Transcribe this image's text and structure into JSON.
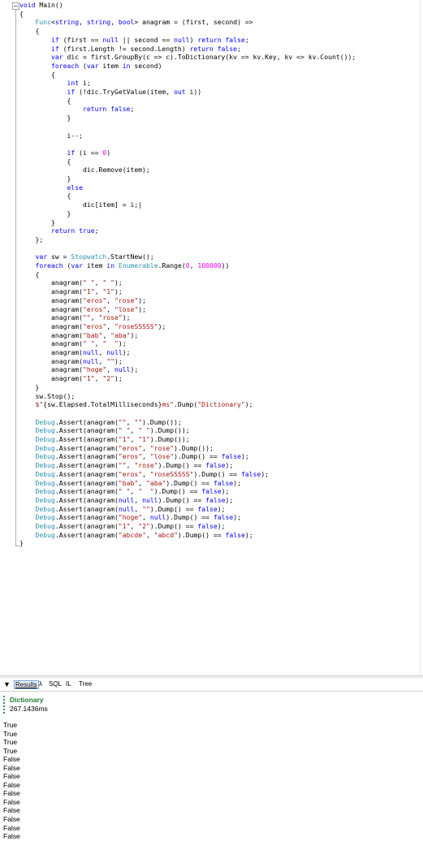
{
  "editor": {
    "fold_glyph": "−",
    "lines": [
      [
        [
          "k",
          "void "
        ],
        [
          "p",
          "Main()"
        ]
      ],
      [
        [
          "p",
          "{"
        ]
      ],
      [
        [
          "p",
          "    "
        ],
        [
          "ty",
          "Func"
        ],
        [
          "p",
          "<"
        ],
        [
          "k",
          "string"
        ],
        [
          "p",
          ", "
        ],
        [
          "k",
          "string"
        ],
        [
          "p",
          ", "
        ],
        [
          "k",
          "bool"
        ],
        [
          "p",
          "> anagram = (first, second) =>"
        ]
      ],
      [
        [
          "p",
          "    {"
        ]
      ],
      [
        [
          "p",
          "        "
        ],
        [
          "k",
          "if"
        ],
        [
          "p",
          " (first == "
        ],
        [
          "k",
          "null"
        ],
        [
          "p",
          " || second == "
        ],
        [
          "k",
          "null"
        ],
        [
          "p",
          ") "
        ],
        [
          "k",
          "return false"
        ],
        [
          "p",
          ";"
        ]
      ],
      [
        [
          "p",
          "        "
        ],
        [
          "k",
          "if"
        ],
        [
          "p",
          " (first.Length != second.Length) "
        ],
        [
          "k",
          "return false"
        ],
        [
          "p",
          ";"
        ]
      ],
      [
        [
          "p",
          "        "
        ],
        [
          "k",
          "var"
        ],
        [
          "p",
          " dic = first.GroupBy(c => c).ToDictionary(kv => kv.Key, kv => kv.Count());"
        ]
      ],
      [
        [
          "p",
          "        "
        ],
        [
          "k",
          "foreach"
        ],
        [
          "p",
          " ("
        ],
        [
          "k",
          "var"
        ],
        [
          "p",
          " item "
        ],
        [
          "k",
          "in"
        ],
        [
          "p",
          " second)"
        ]
      ],
      [
        [
          "p",
          "        {"
        ]
      ],
      [
        [
          "p",
          "            "
        ],
        [
          "k",
          "int"
        ],
        [
          "p",
          " i;"
        ]
      ],
      [
        [
          "p",
          "            "
        ],
        [
          "k",
          "if"
        ],
        [
          "p",
          " (!dic.TryGetValue(item, "
        ],
        [
          "k",
          "out"
        ],
        [
          "p",
          " i))"
        ]
      ],
      [
        [
          "p",
          "            {"
        ]
      ],
      [
        [
          "p",
          "                "
        ],
        [
          "k",
          "return false"
        ],
        [
          "p",
          ";"
        ]
      ],
      [
        [
          "p",
          "            }"
        ]
      ],
      [],
      [
        [
          "p",
          "            i--;"
        ]
      ],
      [],
      [
        [
          "p",
          "            "
        ],
        [
          "k",
          "if"
        ],
        [
          "p",
          " (i == "
        ],
        [
          "n",
          "0"
        ],
        [
          "p",
          ")"
        ]
      ],
      [
        [
          "p",
          "            {"
        ]
      ],
      [
        [
          "p",
          "                dic.Remove(item);"
        ]
      ],
      [
        [
          "p",
          "            }"
        ]
      ],
      [
        [
          "p",
          "            "
        ],
        [
          "k",
          "else"
        ]
      ],
      [
        [
          "p",
          "            {"
        ]
      ],
      [
        [
          "p",
          "                dic[item] = i;|"
        ]
      ],
      [
        [
          "p",
          "            }"
        ]
      ],
      [
        [
          "p",
          "        }"
        ]
      ],
      [
        [
          "p",
          "        "
        ],
        [
          "k",
          "return true"
        ],
        [
          "p",
          ";"
        ]
      ],
      [
        [
          "p",
          "    };"
        ]
      ],
      [],
      [
        [
          "p",
          "    "
        ],
        [
          "k",
          "var"
        ],
        [
          "p",
          " sw = "
        ],
        [
          "ty",
          "Stopwatch"
        ],
        [
          "p",
          ".StartNew();"
        ]
      ],
      [
        [
          "p",
          "    "
        ],
        [
          "k",
          "foreach"
        ],
        [
          "p",
          " ("
        ],
        [
          "k",
          "var"
        ],
        [
          "p",
          " item "
        ],
        [
          "k",
          "in"
        ],
        [
          "p",
          " "
        ],
        [
          "ty",
          "Enumerable"
        ],
        [
          "p",
          ".Range("
        ],
        [
          "n",
          "0"
        ],
        [
          "p",
          ", "
        ],
        [
          "n",
          "100000"
        ],
        [
          "p",
          "))"
        ]
      ],
      [
        [
          "p",
          "    {"
        ]
      ],
      [
        [
          "p",
          "        anagram("
        ],
        [
          "s",
          "\" \""
        ],
        [
          "p",
          ", "
        ],
        [
          "s",
          "\" \""
        ],
        [
          "p",
          ");"
        ]
      ],
      [
        [
          "p",
          "        anagram("
        ],
        [
          "s",
          "\"1\""
        ],
        [
          "p",
          ", "
        ],
        [
          "s",
          "\"1\""
        ],
        [
          "p",
          ");"
        ]
      ],
      [
        [
          "p",
          "        anagram("
        ],
        [
          "s",
          "\"eros\""
        ],
        [
          "p",
          ", "
        ],
        [
          "s",
          "\"rose\""
        ],
        [
          "p",
          ");"
        ]
      ],
      [
        [
          "p",
          "        anagram("
        ],
        [
          "s",
          "\"eros\""
        ],
        [
          "p",
          ", "
        ],
        [
          "s",
          "\"lose\""
        ],
        [
          "p",
          ");"
        ]
      ],
      [
        [
          "p",
          "        anagram("
        ],
        [
          "s",
          "\"\""
        ],
        [
          "p",
          ", "
        ],
        [
          "s",
          "\"rose\""
        ],
        [
          "p",
          ");"
        ]
      ],
      [
        [
          "p",
          "        anagram("
        ],
        [
          "s",
          "\"eros\""
        ],
        [
          "p",
          ", "
        ],
        [
          "s",
          "\"roseSSSSS\""
        ],
        [
          "p",
          ");"
        ]
      ],
      [
        [
          "p",
          "        anagram("
        ],
        [
          "s",
          "\"bab\""
        ],
        [
          "p",
          ", "
        ],
        [
          "s",
          "\"aba\""
        ],
        [
          "p",
          ");"
        ]
      ],
      [
        [
          "p",
          "        anagram("
        ],
        [
          "s",
          "\" \""
        ],
        [
          "p",
          ", "
        ],
        [
          "s",
          "\"  \""
        ],
        [
          "p",
          ");"
        ]
      ],
      [
        [
          "p",
          "        anagram("
        ],
        [
          "k",
          "null"
        ],
        [
          "p",
          ", "
        ],
        [
          "k",
          "null"
        ],
        [
          "p",
          ");"
        ]
      ],
      [
        [
          "p",
          "        anagram("
        ],
        [
          "k",
          "null"
        ],
        [
          "p",
          ", "
        ],
        [
          "s",
          "\"\""
        ],
        [
          "p",
          ");"
        ]
      ],
      [
        [
          "p",
          "        anagram("
        ],
        [
          "s",
          "\"hoge\""
        ],
        [
          "p",
          ", "
        ],
        [
          "k",
          "null"
        ],
        [
          "p",
          ");"
        ]
      ],
      [
        [
          "p",
          "        anagram("
        ],
        [
          "s",
          "\"1\""
        ],
        [
          "p",
          ", "
        ],
        [
          "s",
          "\"2\""
        ],
        [
          "p",
          ");"
        ]
      ],
      [
        [
          "p",
          "    }"
        ]
      ],
      [
        [
          "p",
          "    sw.Stop();"
        ]
      ],
      [
        [
          "p",
          "    "
        ],
        [
          "s",
          "$\""
        ],
        [
          "p",
          "{sw.Elapsed.TotalMilliseconds}"
        ],
        [
          "s",
          "ms\""
        ],
        [
          "p",
          ".Dump("
        ],
        [
          "s",
          "\"Dictionary\""
        ],
        [
          "p",
          ");"
        ]
      ],
      [],
      [
        [
          "p",
          "    "
        ],
        [
          "ty",
          "Debug"
        ],
        [
          "p",
          ".Assert(anagram("
        ],
        [
          "s",
          "\"\""
        ],
        [
          "p",
          ", "
        ],
        [
          "s",
          "\"\""
        ],
        [
          "p",
          ").Dump());"
        ]
      ],
      [
        [
          "p",
          "    "
        ],
        [
          "ty",
          "Debug"
        ],
        [
          "p",
          ".Assert(anagram("
        ],
        [
          "s",
          "\" \""
        ],
        [
          "p",
          ", "
        ],
        [
          "s",
          "\" \""
        ],
        [
          "p",
          ").Dump());"
        ]
      ],
      [
        [
          "p",
          "    "
        ],
        [
          "ty",
          "Debug"
        ],
        [
          "p",
          ".Assert(anagram("
        ],
        [
          "s",
          "\"1\""
        ],
        [
          "p",
          ", "
        ],
        [
          "s",
          "\"1\""
        ],
        [
          "p",
          ").Dump());"
        ]
      ],
      [
        [
          "p",
          "    "
        ],
        [
          "ty",
          "Debug"
        ],
        [
          "p",
          ".Assert(anagram("
        ],
        [
          "s",
          "\"eros\""
        ],
        [
          "p",
          ", "
        ],
        [
          "s",
          "\"rose\""
        ],
        [
          "p",
          ").Dump());"
        ]
      ],
      [
        [
          "p",
          "    "
        ],
        [
          "ty",
          "Debug"
        ],
        [
          "p",
          ".Assert(anagram("
        ],
        [
          "s",
          "\"eros\""
        ],
        [
          "p",
          ", "
        ],
        [
          "s",
          "\"lose\""
        ],
        [
          "p",
          ").Dump() == "
        ],
        [
          "k",
          "false"
        ],
        [
          "p",
          ");"
        ]
      ],
      [
        [
          "p",
          "    "
        ],
        [
          "ty",
          "Debug"
        ],
        [
          "p",
          ".Assert(anagram("
        ],
        [
          "s",
          "\"\""
        ],
        [
          "p",
          ", "
        ],
        [
          "s",
          "\"rose\""
        ],
        [
          "p",
          ").Dump() == "
        ],
        [
          "k",
          "false"
        ],
        [
          "p",
          ");"
        ]
      ],
      [
        [
          "p",
          "    "
        ],
        [
          "ty",
          "Debug"
        ],
        [
          "p",
          ".Assert(anagram("
        ],
        [
          "s",
          "\"eros\""
        ],
        [
          "p",
          ", "
        ],
        [
          "s",
          "\"roseSSSSS\""
        ],
        [
          "p",
          ").Dump() == "
        ],
        [
          "k",
          "false"
        ],
        [
          "p",
          ");"
        ]
      ],
      [
        [
          "p",
          "    "
        ],
        [
          "ty",
          "Debug"
        ],
        [
          "p",
          ".Assert(anagram("
        ],
        [
          "s",
          "\"bab\""
        ],
        [
          "p",
          ", "
        ],
        [
          "s",
          "\"aba\""
        ],
        [
          "p",
          ").Dump() == "
        ],
        [
          "k",
          "false"
        ],
        [
          "p",
          ");"
        ]
      ],
      [
        [
          "p",
          "    "
        ],
        [
          "ty",
          "Debug"
        ],
        [
          "p",
          ".Assert(anagram("
        ],
        [
          "s",
          "\" \""
        ],
        [
          "p",
          ", "
        ],
        [
          "s",
          "\"  \""
        ],
        [
          "p",
          ").Dump() == "
        ],
        [
          "k",
          "false"
        ],
        [
          "p",
          ");"
        ]
      ],
      [
        [
          "p",
          "    "
        ],
        [
          "ty",
          "Debug"
        ],
        [
          "p",
          ".Assert(anagram("
        ],
        [
          "k",
          "null"
        ],
        [
          "p",
          ", "
        ],
        [
          "k",
          "null"
        ],
        [
          "p",
          ").Dump() == "
        ],
        [
          "k",
          "false"
        ],
        [
          "p",
          ");"
        ]
      ],
      [
        [
          "p",
          "    "
        ],
        [
          "ty",
          "Debug"
        ],
        [
          "p",
          ".Assert(anagram("
        ],
        [
          "k",
          "null"
        ],
        [
          "p",
          ", "
        ],
        [
          "s",
          "\"\""
        ],
        [
          "p",
          ").Dump() == "
        ],
        [
          "k",
          "false"
        ],
        [
          "p",
          ");"
        ]
      ],
      [
        [
          "p",
          "    "
        ],
        [
          "ty",
          "Debug"
        ],
        [
          "p",
          ".Assert(anagram("
        ],
        [
          "s",
          "\"hoge\""
        ],
        [
          "p",
          ", "
        ],
        [
          "k",
          "null"
        ],
        [
          "p",
          ").Dump() == "
        ],
        [
          "k",
          "false"
        ],
        [
          "p",
          ");"
        ]
      ],
      [
        [
          "p",
          "    "
        ],
        [
          "ty",
          "Debug"
        ],
        [
          "p",
          ".Assert(anagram("
        ],
        [
          "s",
          "\"1\""
        ],
        [
          "p",
          ", "
        ],
        [
          "s",
          "\"2\""
        ],
        [
          "p",
          ").Dump() == "
        ],
        [
          "k",
          "false"
        ],
        [
          "p",
          ");"
        ]
      ],
      [
        [
          "p",
          "    "
        ],
        [
          "ty",
          "Debug"
        ],
        [
          "p",
          ".Assert(anagram("
        ],
        [
          "s",
          "\"abcde\""
        ],
        [
          "p",
          ", "
        ],
        [
          "s",
          "\"abcd\""
        ],
        [
          "p",
          ").Dump() == "
        ],
        [
          "k",
          "false"
        ],
        [
          "p",
          ");"
        ]
      ],
      [
        [
          "p",
          "}"
        ]
      ]
    ]
  },
  "tabs": {
    "collapse_glyph": "▼",
    "results": "Results",
    "lambda": "λ",
    "sql": "SQL",
    "il": "IL",
    "tree": "Tree"
  },
  "output": {
    "dump_title": "Dictionary",
    "dump_value": "267.1436ms",
    "results": [
      "True",
      "True",
      "True",
      "True",
      "False",
      "False",
      "False",
      "False",
      "False",
      "False",
      "False",
      "False",
      "False",
      "False"
    ]
  },
  "colors": {
    "keyword": "#0000ff",
    "string": "#a31515",
    "type": "#2b91af",
    "number": "#ee00ee",
    "dump_title": "#1a7f37"
  }
}
